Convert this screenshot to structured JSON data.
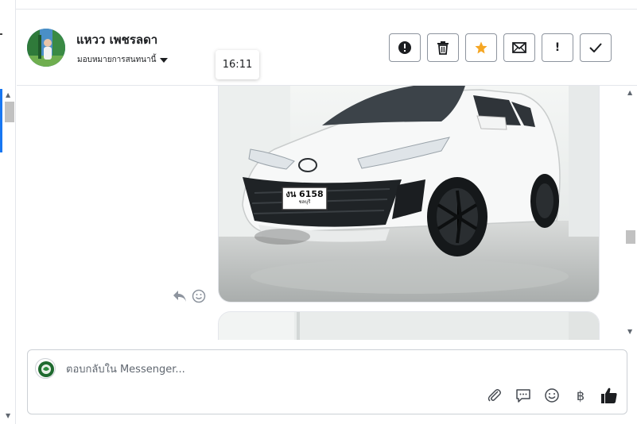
{
  "contact": {
    "name": "แหวว เพชรลดา",
    "assign_label": "มอบหมายการสนทนานี้"
  },
  "tooltip": {
    "time": "16:11"
  },
  "actions": {
    "spam_icon": "exclamation-circle-icon",
    "delete_icon": "trash-icon",
    "star_icon": "star-icon",
    "unread_icon": "envelope-icon",
    "follow_up_label": "!",
    "done_icon": "check-icon"
  },
  "messages": {
    "photo1": {
      "plate_number": "งน 6158",
      "plate_province": "ชลบุรี"
    }
  },
  "composer": {
    "placeholder": "ตอบกลับใน Messenger...",
    "currency_label": "฿"
  },
  "colors": {
    "accent": "#1877f2",
    "star": "#f5a623",
    "border": "#8d949e",
    "muted_icon": "#8d949e"
  }
}
